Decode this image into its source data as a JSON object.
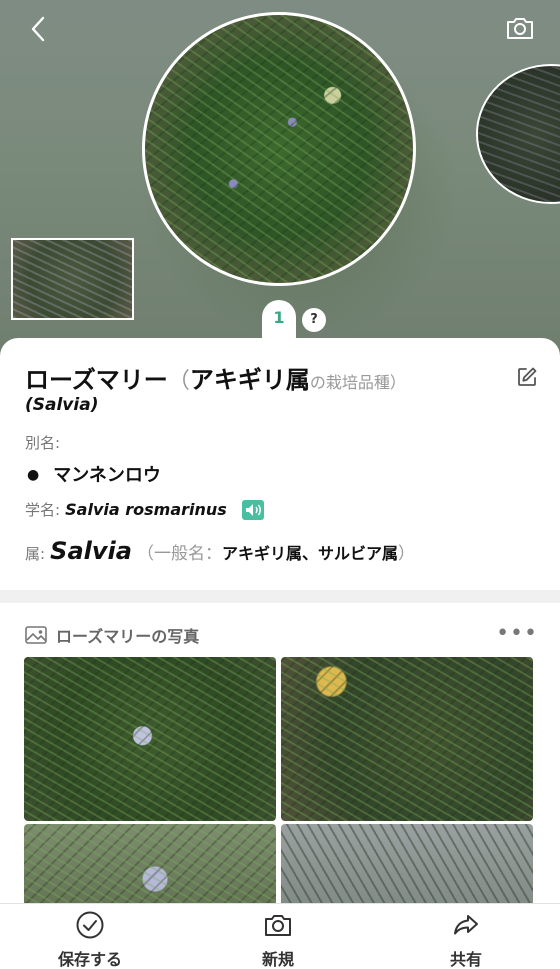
{
  "header": {
    "back_icon": "chevron-left-icon",
    "camera_icon": "camera-icon",
    "photo_index": "1",
    "help_label": "?"
  },
  "plant": {
    "name": "ローズマリー",
    "paren_open": "（",
    "genus_name": "アキギリ属",
    "suffix": "の栽培品種）",
    "scientific_paren": "(Salvia)",
    "alias_label": "別名:",
    "aliases": [
      "マンネンロウ"
    ],
    "scientific_label": "学名:",
    "scientific_name": "Salvia rosmarinus",
    "genus_label": "属:",
    "genus_latin": "Salvia",
    "common_prefix": "（一般名：",
    "common_names": "アキギリ属、サルビア属",
    "common_suffix": "）"
  },
  "photos": {
    "title": "ローズマリーの写真",
    "more_label": "•••"
  },
  "bottom_bar": {
    "save_label": "保存する",
    "new_label": "新規",
    "share_label": "共有"
  },
  "colors": {
    "accent": "#3aa884",
    "speaker": "#48bfa0"
  }
}
